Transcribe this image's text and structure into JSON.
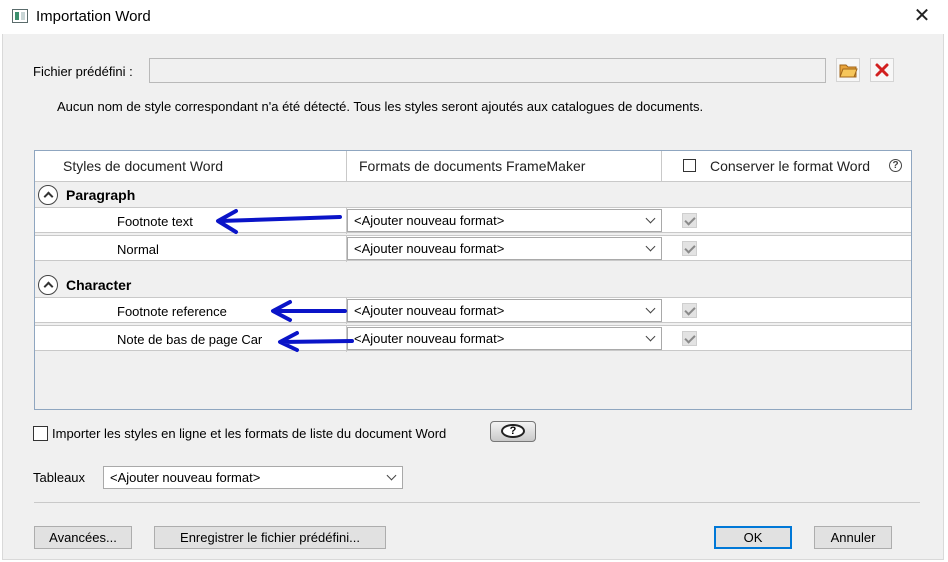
{
  "window": {
    "title": "Importation Word"
  },
  "preset": {
    "label": "Fichier prédéfini :",
    "value": "",
    "open_icon": "folder-open-icon",
    "clear_icon": "red-x-icon"
  },
  "message": "Aucun nom de style correspondant n'a été détecté. Tous les styles seront ajoutés aux catalogues de documents.",
  "grid": {
    "columns": {
      "word_styles": "Styles de document Word",
      "fm_formats": "Formats de documents FrameMaker",
      "keep_format": "Conserver le format Word"
    },
    "help_icon": "?",
    "groups": [
      {
        "name": "Paragraph",
        "rows": [
          {
            "style": "Footnote text",
            "format": "<Ajouter nouveau format>",
            "keep": true
          },
          {
            "style": "Normal",
            "format": "<Ajouter nouveau format>",
            "keep": true
          }
        ]
      },
      {
        "name": "Character",
        "rows": [
          {
            "style": "Footnote reference",
            "format": "<Ajouter nouveau format>",
            "keep": true
          },
          {
            "style": "Note de bas de page Car",
            "format": "<Ajouter nouveau format>",
            "keep": true
          }
        ]
      }
    ]
  },
  "import_inline": {
    "label": "Importer les styles en ligne et les formats de liste du document Word",
    "checked": false
  },
  "help_button_icon": "?",
  "tables": {
    "label": "Tableaux",
    "value": "<Ajouter nouveau format>"
  },
  "buttons": {
    "advanced": "Avancées...",
    "save_preset": "Enregistrer le fichier prédéfini...",
    "ok": "OK",
    "cancel": "Annuler"
  },
  "colors": {
    "annotation_arrow": "#0a14c8",
    "focus_border": "#0078d7",
    "clear_icon": "#d22020"
  }
}
